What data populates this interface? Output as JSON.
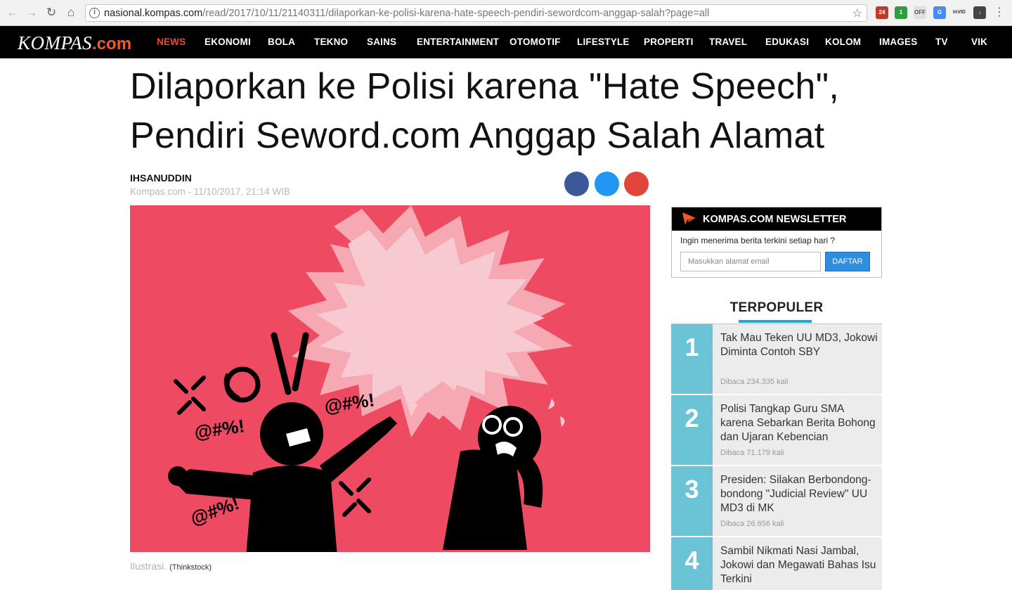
{
  "browser": {
    "url_host": "nasional.kompas.com",
    "url_path": "/read/2017/10/11/21140311/dilaporkan-ke-polisi-karena-hate-speech-pendiri-sewordcom-anggap-salah?page=all",
    "ext_badge_1": "24",
    "ext_badge_2": "1",
    "ext_label_off": "OFF",
    "ext_label_invid": "InVID"
  },
  "site": {
    "logo_text": "KOMPAS",
    "logo_suffix": ".com",
    "nav": [
      "NEWS",
      "EKONOMI",
      "BOLA",
      "TEKNO",
      "SAINS",
      "ENTERTAINMENT",
      "OTOMOTIF",
      "LIFESTYLE",
      "PROPERTI",
      "TRAVEL",
      "EDUKASI",
      "KOLOM",
      "IMAGES",
      "TV",
      "VIK"
    ],
    "active_color": "#ef4d2d"
  },
  "article": {
    "headline_line1": "Dilaporkan ke Polisi karena \"Hate Speech\",",
    "headline_line2": "Pendiri Seword.com Anggap Salah Alamat",
    "author": "IHSANUDDIN",
    "meta": "Kompas.com - 11/10/2017, 21:14 WIB",
    "image_bg": "#ee4a62",
    "curse_1": "@#%!",
    "curse_2": "@#%!",
    "curse_3": "@#%!",
    "caption": "Ilustrasi.",
    "caption_credit": "(Thinkstock)"
  },
  "newsletter": {
    "title": "KOMPAS.COM NEWSLETTER",
    "prompt": "Ingin menerima berita terkini setiap hari ?",
    "input_placeholder": "Masukkan alamat email",
    "button": "DAFTAR"
  },
  "popular": {
    "title": "TERPOPULER",
    "items": [
      {
        "num": "1",
        "title": "Tak Mau Teken UU MD3, Jokowi Diminta Contoh SBY",
        "reads": "Dibaca 234.335 kali"
      },
      {
        "num": "2",
        "title": "Polisi Tangkap Guru SMA karena Sebarkan Berita Bohong dan Ujaran Kebencian",
        "reads": "Dibaca 71.179 kali"
      },
      {
        "num": "3",
        "title": "Presiden: Silakan Berbondong-bondong \"Judicial Review\" UU MD3 di MK",
        "reads": "Dibaca 26.656 kali"
      },
      {
        "num": "4",
        "title": "Sambil Nikmati Nasi Jambal, Jokowi dan Megawati Bahas Isu Terkini",
        "reads": ""
      }
    ]
  }
}
